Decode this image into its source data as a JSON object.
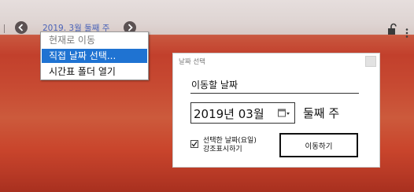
{
  "header": {
    "date_label": "2019. 3월 둘째 주"
  },
  "context_menu": {
    "items": [
      {
        "label": "현재로 이동",
        "state": "disabled"
      },
      {
        "label": "직접 날짜 선택...",
        "state": "selected"
      },
      {
        "label": "시간표 폴더 열기",
        "state": "normal"
      }
    ]
  },
  "dialog": {
    "title": "날짜 선택",
    "field_label": "이동할 날짜",
    "month_value": "2019년 03월",
    "week_label": "둘째 주",
    "checkbox_label_line1": "선택한 날짜(요일)",
    "checkbox_label_line2": "강조표시하기",
    "checkbox_checked": true,
    "go_button_label": "이동하기"
  },
  "colors": {
    "accent_blue": "#1f73d2",
    "date_link": "#4a63b8",
    "background_sunset": "#c2402c"
  }
}
